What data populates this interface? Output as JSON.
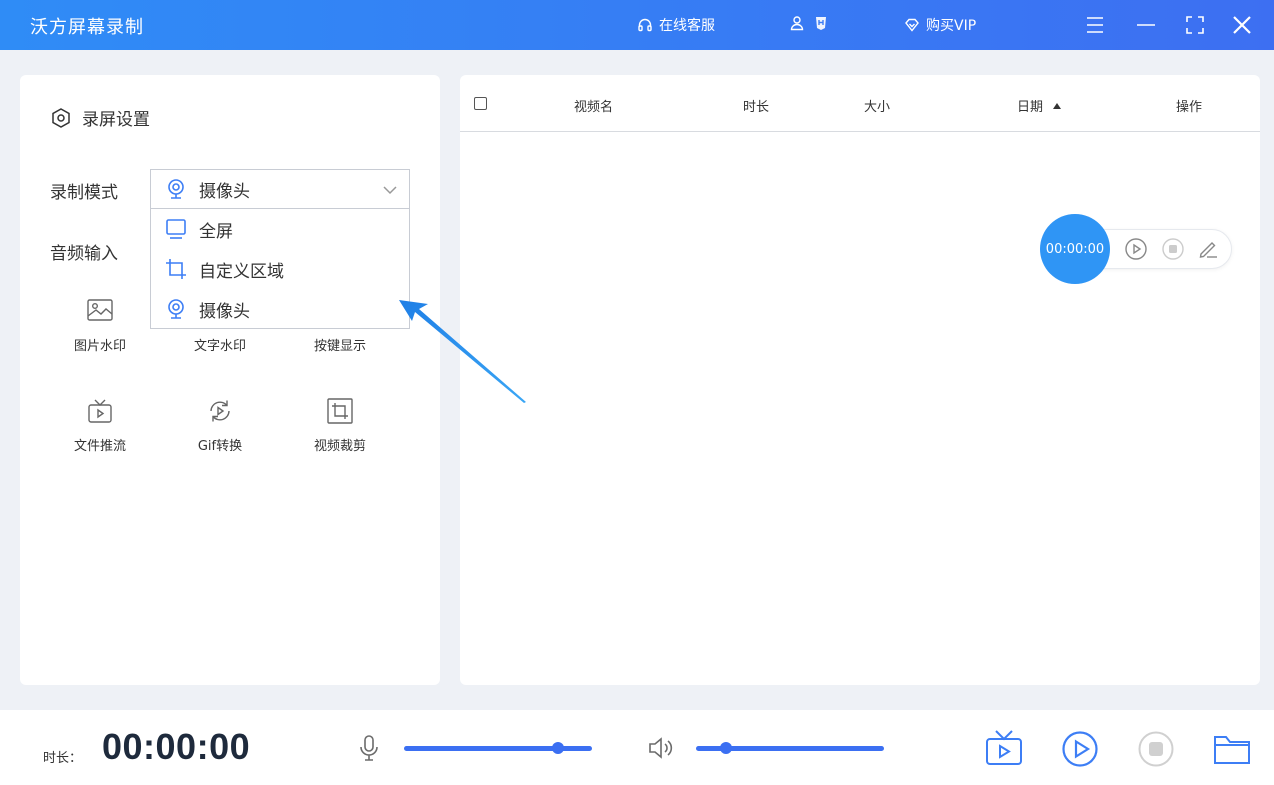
{
  "app": {
    "title": "沃方屏幕录制",
    "online_service": "在线客服",
    "buy_vip": "购买VIP",
    "brand_color": "#3d7ef5"
  },
  "settings": {
    "section_title": "录屏设置",
    "record_mode_label": "录制模式",
    "record_mode_value": "摄像头",
    "audio_input_label": "音频输入",
    "dropdown_options": [
      {
        "label": "全屏",
        "icon": "monitor-icon"
      },
      {
        "label": "自定义区域",
        "icon": "crop-icon"
      },
      {
        "label": "摄像头",
        "icon": "webcam-icon"
      }
    ]
  },
  "tools": [
    {
      "label": "图片水印",
      "icon": "image-watermark-icon"
    },
    {
      "label": "文字水印",
      "icon": "text-watermark-icon"
    },
    {
      "label": "按键显示",
      "icon": "keyboard-icon"
    },
    {
      "label": "文件推流",
      "icon": "tv-icon"
    },
    {
      "label": "Gif转换",
      "icon": "gif-convert-icon"
    },
    {
      "label": "视频裁剪",
      "icon": "crop-video-icon"
    }
  ],
  "table": {
    "columns": [
      "视频名",
      "时长",
      "大小",
      "日期",
      "操作"
    ],
    "sort_column": "日期",
    "sort_direction": "ascending"
  },
  "floating_widget": {
    "time": "00:00:00"
  },
  "bottom": {
    "duration_label": "时长：",
    "duration_value": "00:00:00",
    "mic_level": 0.82,
    "speaker_level": 0.16
  }
}
